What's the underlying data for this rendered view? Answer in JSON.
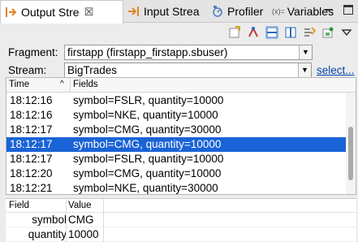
{
  "tabs": [
    {
      "label": "Output Stre",
      "active": true,
      "closable": true,
      "icon": "output-stream-icon"
    },
    {
      "label": "Input Strea",
      "active": false,
      "icon": "input-stream-icon"
    },
    {
      "label": "Profiler",
      "active": false,
      "icon": "profiler-icon"
    },
    {
      "label": "Variables",
      "active": false,
      "icon": "variables-icon",
      "prefix": "(x)="
    }
  ],
  "window_controls": {
    "minimize": "minimize-icon",
    "maximize": "maximize-icon"
  },
  "toolbar": [
    "export-icon",
    "pin-icon",
    "layout-horizontal-icon",
    "layout-vertical-icon",
    "filter-icon",
    "settings-icon",
    "view-menu-icon"
  ],
  "form": {
    "fragment_label": "Fragment:",
    "fragment_value": "firstapp (firstapp_firstapp.sbuser)",
    "stream_label": "Stream:",
    "stream_value": "BigTrades",
    "select_link": "select..."
  },
  "table": {
    "columns": [
      "Time",
      "Fields"
    ],
    "sort_indicator": "^",
    "rows": [
      {
        "time": "18:12:16",
        "fields": "symbol=FSLR, quantity=10000",
        "selected": false
      },
      {
        "time": "18:12:16",
        "fields": "symbol=NKE, quantity=10000",
        "selected": false
      },
      {
        "time": "18:12:17",
        "fields": "symbol=CMG, quantity=30000",
        "selected": false
      },
      {
        "time": "18:12:17",
        "fields": "symbol=CMG, quantity=10000",
        "selected": true
      },
      {
        "time": "18:12:17",
        "fields": "symbol=FSLR, quantity=10000",
        "selected": false
      },
      {
        "time": "18:12:20",
        "fields": "symbol=CMG, quantity=10000",
        "selected": false
      },
      {
        "time": "18:12:21",
        "fields": "symbol=NKE, quantity=30000",
        "selected": false
      }
    ]
  },
  "detail": {
    "columns": [
      "Field",
      "Value"
    ],
    "rows": [
      {
        "field": "symbol",
        "value": "CMG"
      },
      {
        "field": "quantity",
        "value": "10000"
      }
    ]
  },
  "colors": {
    "selection": "#1a63d6",
    "link": "#0645ad"
  }
}
